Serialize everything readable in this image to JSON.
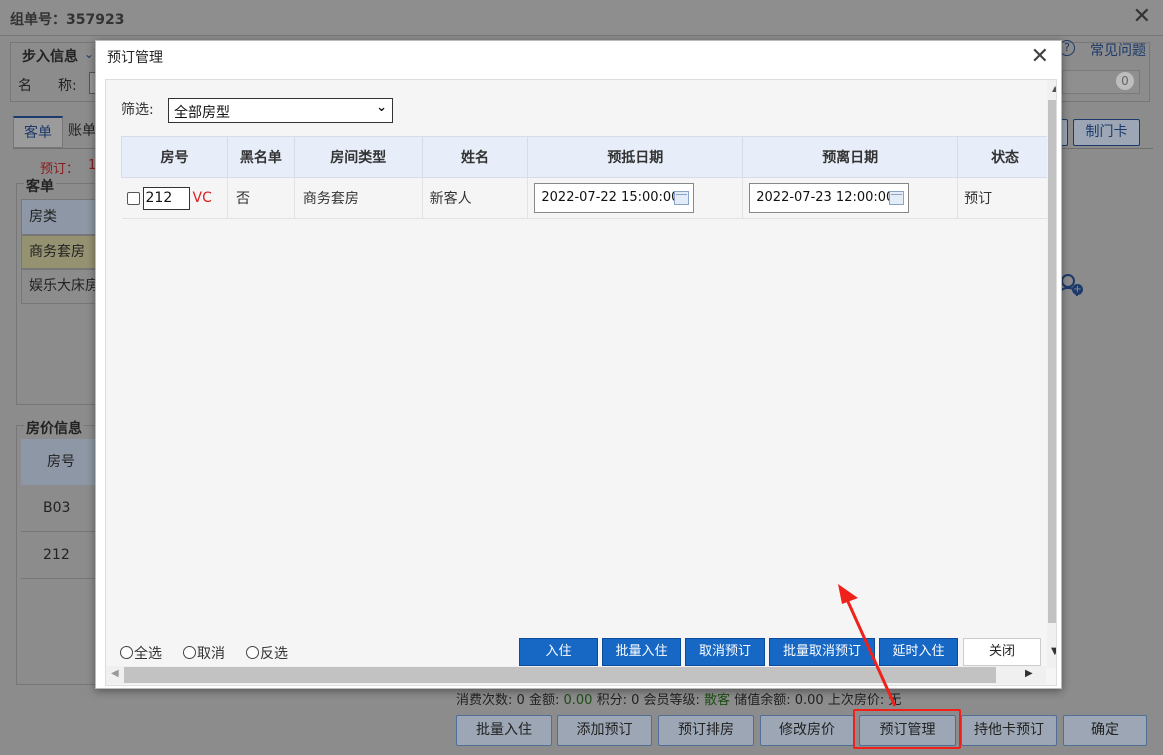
{
  "outer": {
    "title": "组单号：357923",
    "close_glyph": "✕",
    "step_info_label": "步入信息",
    "faq_label": "常见问题",
    "name_label": "名",
    "name_label2": "称:",
    "tab_guest": "客单",
    "tab_account": "账单",
    "booking_count_label": "预订：",
    "booking_count": "1",
    "make_card_button": "制门卡",
    "guest_section_label": "客单",
    "room_type_header": "房类",
    "room_types": [
      "商务套房",
      "娱乐大床房"
    ],
    "price_section_label": "房价信息",
    "room_no_header": "房号",
    "rooms": [
      "B03",
      "212"
    ],
    "status_bar": {
      "consume_label": "消费次数:",
      "consume": "0",
      "amount_label": "金额:",
      "amount": "0.00",
      "points_label": "积分:",
      "points": "0",
      "level_label": "会员等级:",
      "level": "散客",
      "stored_label": "储值余额:",
      "stored": "0.00",
      "last_price_label": "上次房价:",
      "last_price": "无"
    },
    "buttons": [
      "批量入住",
      "添加预订",
      "预订排房",
      "修改房价",
      "预订管理",
      "持他卡预订",
      "确定"
    ]
  },
  "dialog": {
    "title": "预订管理",
    "close_glyph": "✕",
    "filter_label": "筛选:",
    "filter_value": "全部房型",
    "columns": [
      "房号",
      "黑名单",
      "房间类型",
      "姓名",
      "预抵日期",
      "预离日期",
      "状态"
    ],
    "rows": [
      {
        "room": "212",
        "tag": "VC",
        "blacklist": "否",
        "room_type": "商务套房",
        "name": "新客人",
        "arrive": "2022-07-22 15:00:00",
        "depart": "2022-07-23 12:00:00",
        "status": "预订"
      }
    ],
    "select_all": "全选",
    "cancel_select": "取消",
    "invert_select": "反选",
    "actions": [
      "入住",
      "批量入住",
      "取消预订",
      "批量取消预订",
      "延时入住"
    ],
    "close_button": "关闭"
  }
}
